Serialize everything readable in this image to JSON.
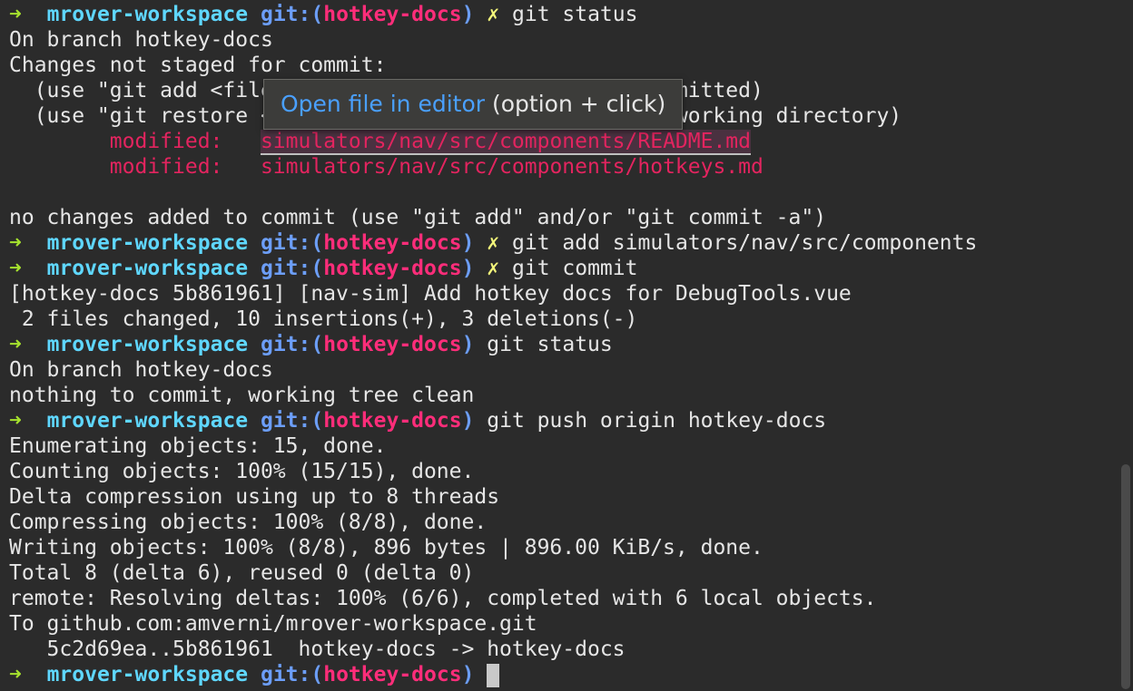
{
  "prompt": {
    "arrow": "➜",
    "dir": "mrover-workspace",
    "git_prefix": "git:(",
    "branch": "hotkey-docs",
    "git_suffix": ")",
    "dirty_mark": "✗"
  },
  "tooltip": {
    "link": "Open file in editor",
    "hint": " (option + click)"
  },
  "lines": [
    {
      "type": "prompt",
      "dirty": true,
      "command": "git status"
    },
    {
      "type": "text",
      "text": "On branch hotkey-docs"
    },
    {
      "type": "text",
      "text": "Changes not staged for commit:"
    },
    {
      "type": "text",
      "text": "  (use \"git add <file>...\" to update what will be committed)"
    },
    {
      "type": "text",
      "text": "  (use \"git restore <file>...\" to discard changes in working directory)"
    },
    {
      "type": "modified",
      "label": "modified:",
      "path": "simulators/nav/src/components/README.md",
      "hover": true
    },
    {
      "type": "modified",
      "label": "modified:",
      "path": "simulators/nav/src/components/hotkeys.md",
      "hover": false
    },
    {
      "type": "text",
      "text": ""
    },
    {
      "type": "text",
      "text": "no changes added to commit (use \"git add\" and/or \"git commit -a\")"
    },
    {
      "type": "prompt",
      "dirty": true,
      "command": "git add simulators/nav/src/components"
    },
    {
      "type": "prompt",
      "dirty": true,
      "command": "git commit"
    },
    {
      "type": "text",
      "text": "[hotkey-docs 5b861961] [nav-sim] Add hotkey docs for DebugTools.vue"
    },
    {
      "type": "text",
      "text": " 2 files changed, 10 insertions(+), 3 deletions(-)"
    },
    {
      "type": "prompt",
      "dirty": false,
      "command": "git status"
    },
    {
      "type": "text",
      "text": "On branch hotkey-docs"
    },
    {
      "type": "text",
      "text": "nothing to commit, working tree clean"
    },
    {
      "type": "prompt",
      "dirty": false,
      "command": "git push origin hotkey-docs"
    },
    {
      "type": "text",
      "text": "Enumerating objects: 15, done."
    },
    {
      "type": "text",
      "text": "Counting objects: 100% (15/15), done."
    },
    {
      "type": "text",
      "text": "Delta compression using up to 8 threads"
    },
    {
      "type": "text",
      "text": "Compressing objects: 100% (8/8), done."
    },
    {
      "type": "text",
      "text": "Writing objects: 100% (8/8), 896 bytes | 896.00 KiB/s, done."
    },
    {
      "type": "text",
      "text": "Total 8 (delta 6), reused 0 (delta 0)"
    },
    {
      "type": "text",
      "text": "remote: Resolving deltas: 100% (6/6), completed with 6 local objects."
    },
    {
      "type": "text",
      "text": "To github.com:amverni/mrover-workspace.git"
    },
    {
      "type": "text",
      "text": "   5c2d69ea..5b861961  hotkey-docs -> hotkey-docs"
    },
    {
      "type": "prompt",
      "dirty": false,
      "command": "",
      "cursor": true
    }
  ],
  "colors": {
    "background": "#2b2b2b",
    "foreground": "#e6e6e6",
    "arrow": "#a6e22e",
    "dir": "#5fd7ff",
    "git": "#6c9ef8",
    "branch": "#ff2d7a",
    "dirty": "#f3f57a",
    "modified": "#e3245f",
    "link": "#4aa0ff"
  }
}
